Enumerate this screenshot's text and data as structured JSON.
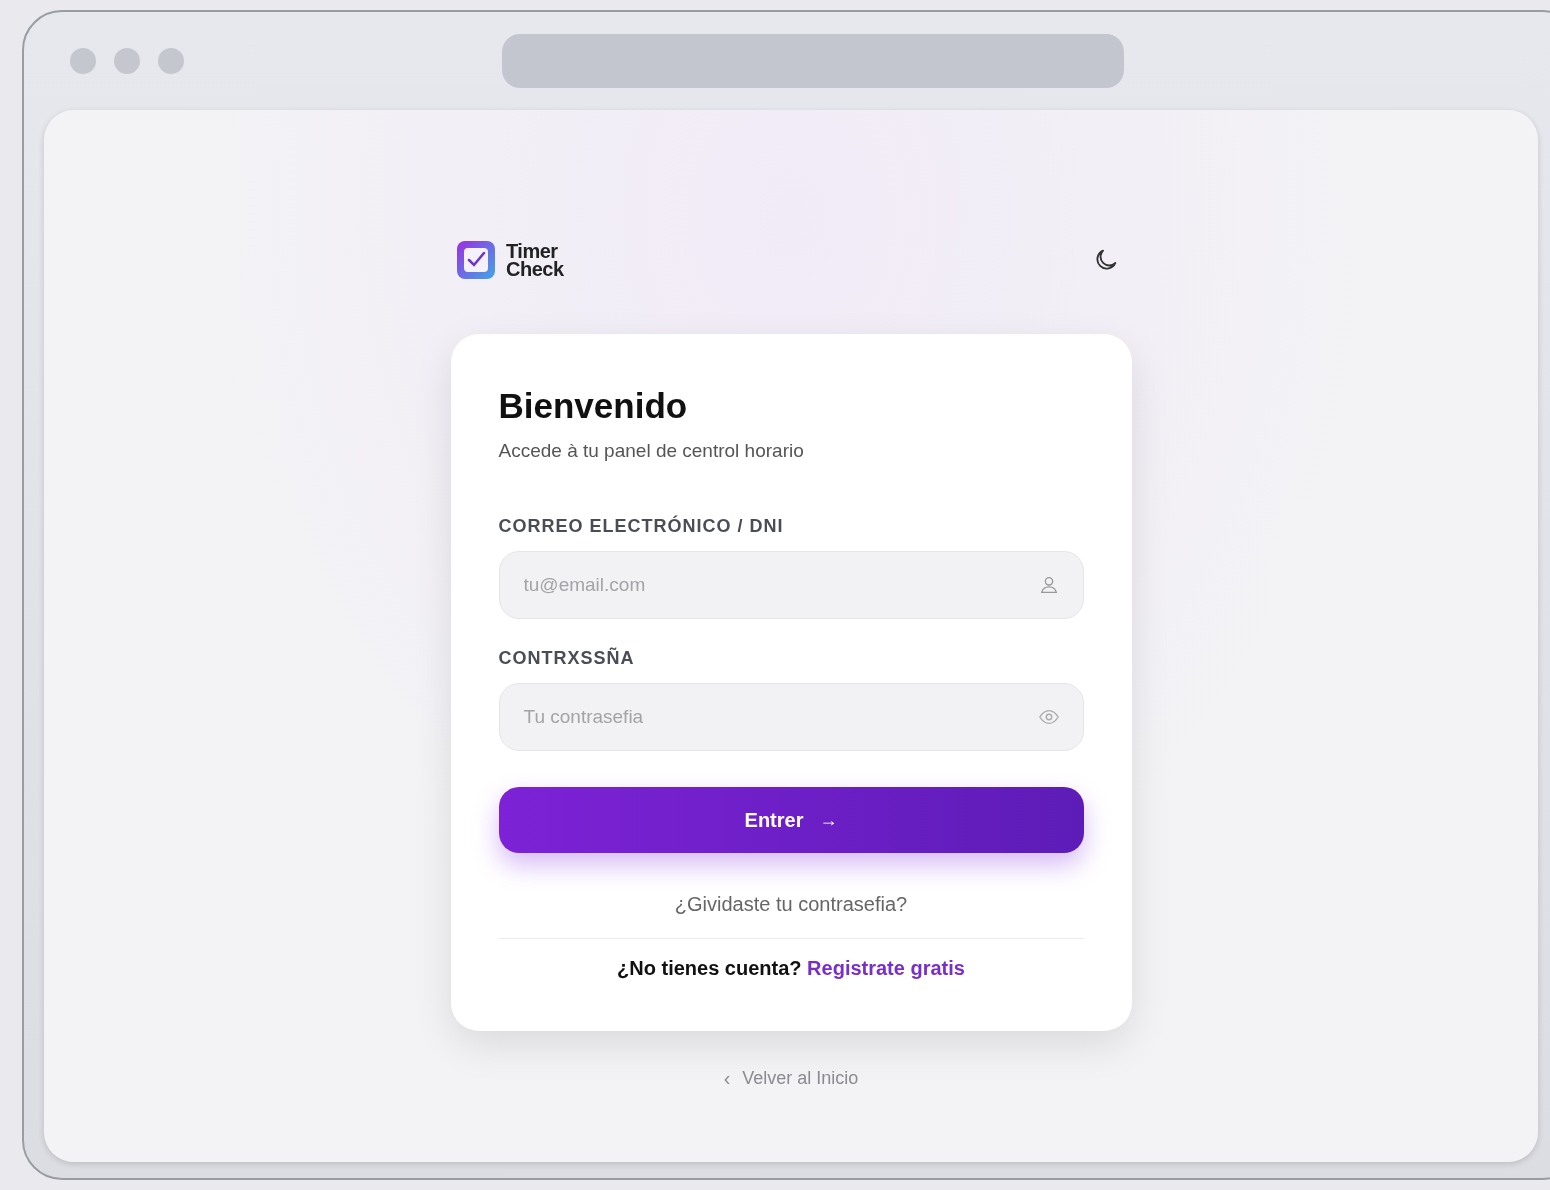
{
  "brand": {
    "lines": [
      "Timer",
      "Check"
    ]
  },
  "card": {
    "title": "Bienvenido",
    "subtitle": "Accede à tu panel de centrol horario",
    "fields": [
      {
        "kind": "email",
        "label": "CORREO ELECTRÓNICO / DNI",
        "placeholder": "tu@email.com"
      },
      {
        "kind": "password",
        "label": "CONTRXSSÑA",
        "placeholder": "Tu contrasefia"
      }
    ],
    "submit": {
      "label": "Entrer",
      "icon": "→"
    },
    "forgot": "¿Gividaste tu contrasefia?",
    "signup": {
      "prompt": "¿No tienes cuenta?",
      "link": "Registrate gratis"
    }
  },
  "back": {
    "icon": "‹",
    "label": "Velver al Inicio"
  }
}
